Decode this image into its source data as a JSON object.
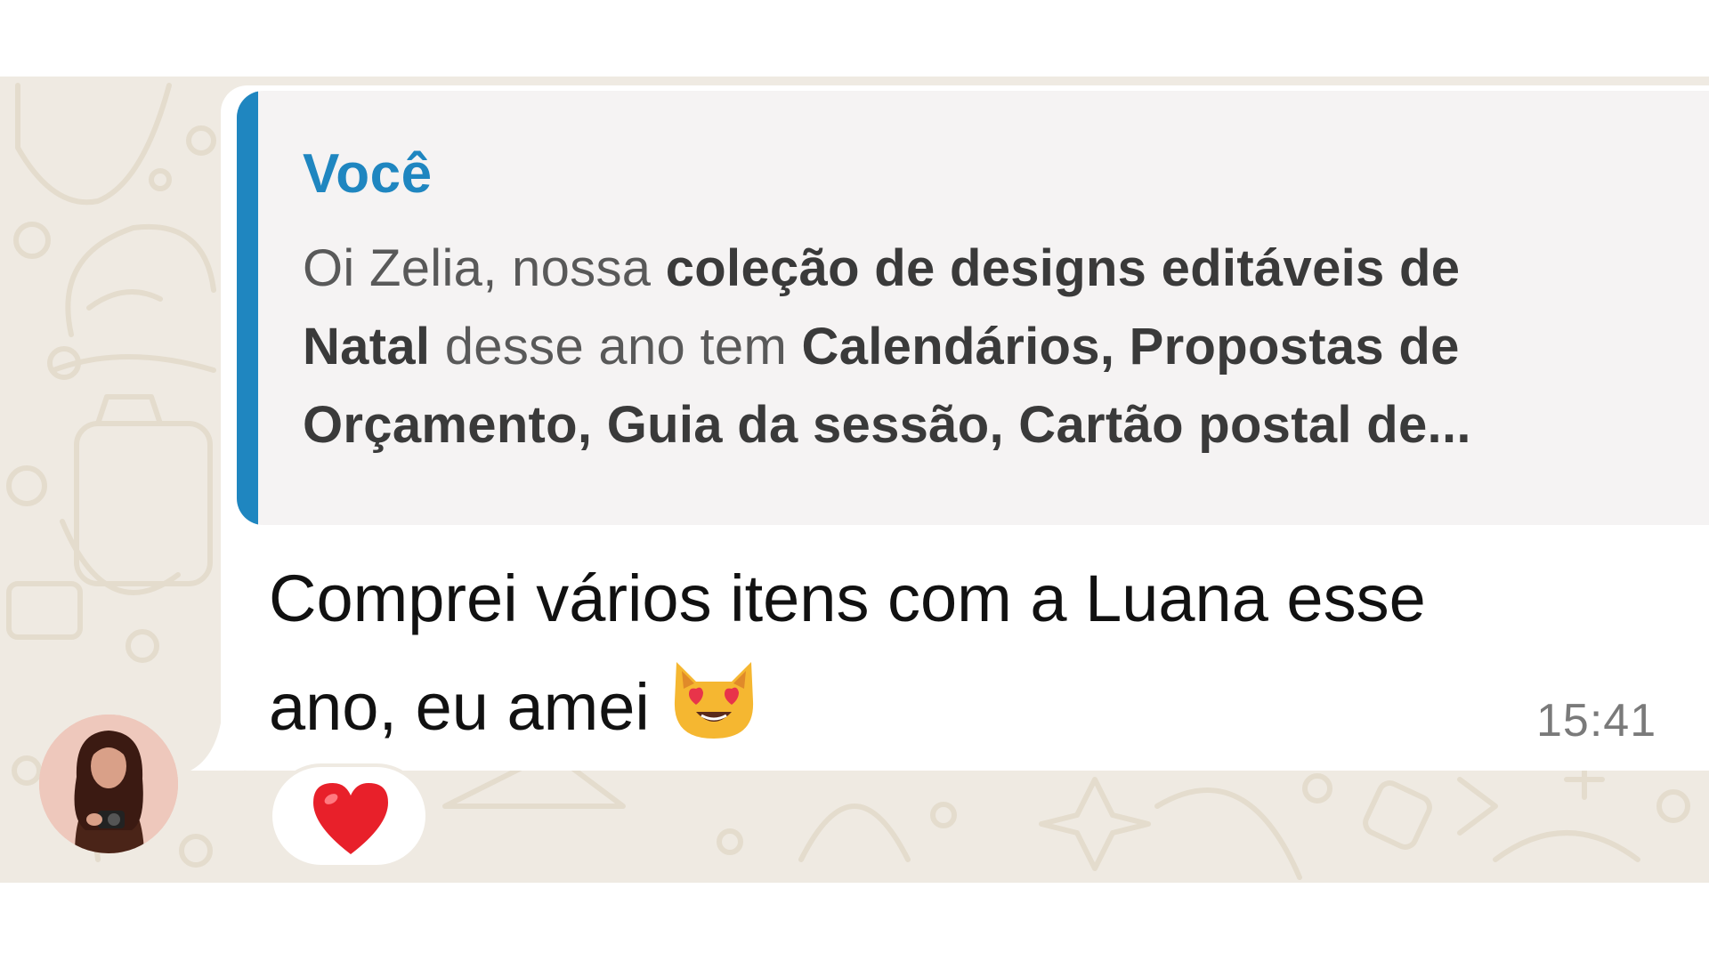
{
  "message": {
    "quoted": {
      "author": "Você",
      "line1": {
        "normal": "Oi Zelia, nossa ",
        "bold": "coleção de designs editáveis de"
      },
      "line2": {
        "bold1": "Natal",
        "normal": " desse ano tem ",
        "bold2": "Calendários, Propostas de"
      },
      "line3": {
        "bold": "Orçamento, Guia da sessão, Cartão postal de..."
      }
    },
    "text_line1": "Comprei vários itens com a  Luana esse",
    "text_line2": "ano, eu amei",
    "emoji": "smiling-cat-heart-eyes",
    "time": "15:41",
    "reaction": "red-heart",
    "quote_color": "#1f86c0",
    "wallpaper_color": "#efeae2"
  }
}
